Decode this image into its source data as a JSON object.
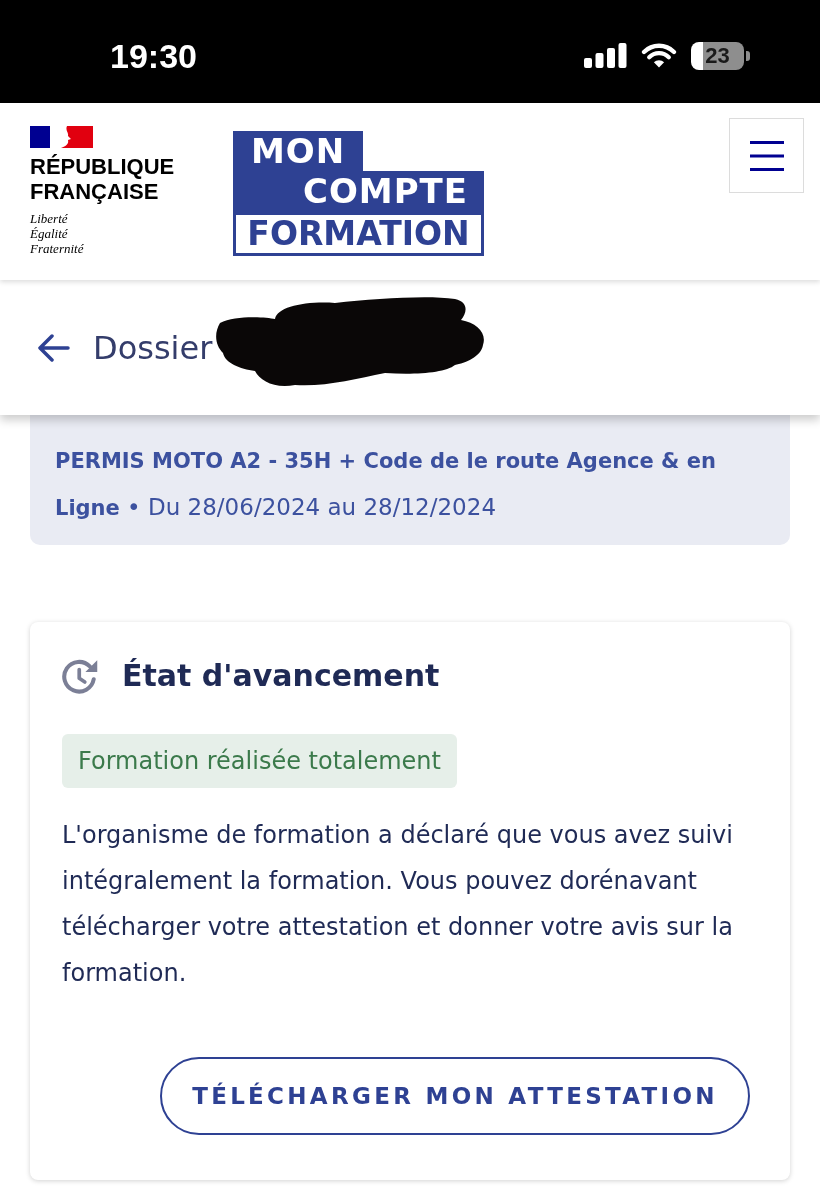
{
  "status_bar": {
    "time": "19:30",
    "battery": "23"
  },
  "header": {
    "government": {
      "name": "RÉPUBLIQUE FRANÇAISE",
      "motto": "Liberté Égalité Fraternité"
    },
    "logo": [
      {
        "text": "MON",
        "kind": "filled"
      },
      {
        "text": "COMPTE",
        "kind": "filled"
      },
      {
        "text": "FORMATION",
        "kind": "outlined"
      }
    ]
  },
  "page": {
    "title": "Dossier"
  },
  "summary": {
    "text": "**PERMIS MOTO A2 - 35H + Code de le route Agence & en Ligne** • Du 28/06/2024 au 28/12/2024"
  },
  "progress_card": {
    "title": "État d'avancement",
    "status": "Formation réalisée totalement",
    "description": "L'organisme de formation a déclaré que vous avez suivi intégralement la formation. Vous pouvez dorénavant télécharger votre attestation et donner votre avis sur la formation.",
    "button": "TÉLÉCHARGER MON ATTESTATION"
  }
}
